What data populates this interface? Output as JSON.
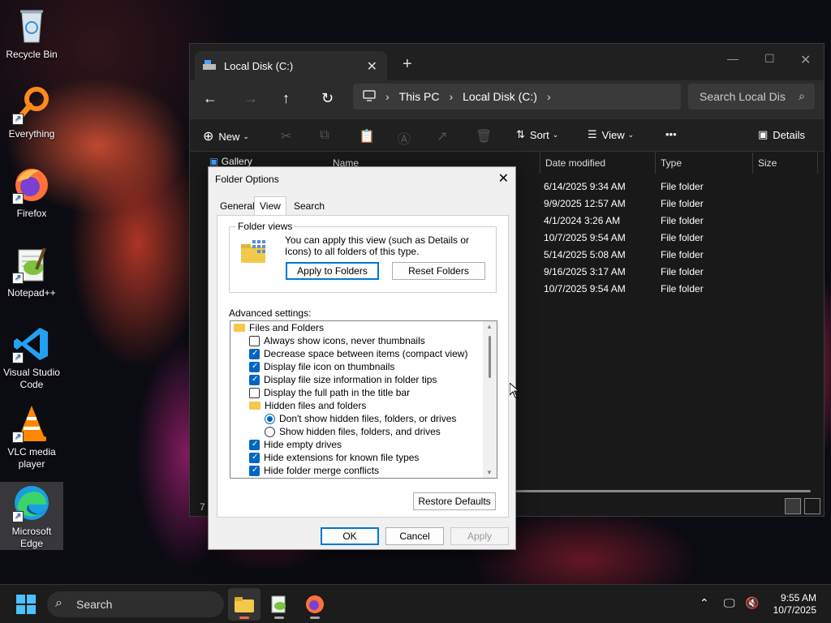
{
  "desktop": {
    "icons": [
      {
        "label": "Recycle Bin"
      },
      {
        "label": "Everything"
      },
      {
        "label": "Firefox"
      },
      {
        "label": "Notepad++"
      },
      {
        "label": "Visual Studio Code"
      },
      {
        "label": "VLC media player"
      },
      {
        "label": "Microsoft Edge"
      }
    ]
  },
  "explorer": {
    "tab_title": "Local Disk (C:)",
    "breadcrumb": [
      "This PC",
      "Local Disk (C:)"
    ],
    "search_placeholder": "Search Local Dis",
    "toolbar": {
      "new": "New",
      "sort": "Sort",
      "view": "View",
      "more": "•••",
      "details": "Details"
    },
    "nav_pane_top": "Gallery",
    "columns": {
      "name": "Name",
      "date": "Date modified",
      "type": "Type",
      "size": "Size"
    },
    "rows": [
      {
        "date": "6/14/2025 9:34 AM",
        "type": "File folder"
      },
      {
        "date": "9/9/2025 12:57 AM",
        "type": "File folder"
      },
      {
        "date": "4/1/2024 3:26 AM",
        "type": "File folder"
      },
      {
        "date": "10/7/2025 9:54 AM",
        "type": "File folder"
      },
      {
        "date": "5/14/2025 5:08 AM",
        "type": "File folder"
      },
      {
        "date": "9/16/2025 3:17 AM",
        "type": "File folder"
      },
      {
        "date": "10/7/2025 9:54 AM",
        "type": "File folder"
      }
    ],
    "status_count": "7"
  },
  "dialog": {
    "title": "Folder Options",
    "tabs": [
      "General",
      "View",
      "Search"
    ],
    "folder_views": {
      "legend": "Folder views",
      "text": "You can apply this view (such as Details or Icons) to all folders of this type.",
      "apply_btn": "Apply to Folders",
      "reset_btn": "Reset Folders"
    },
    "advanced_label": "Advanced settings:",
    "tree": [
      {
        "kind": "folder",
        "label": "Files and Folders"
      },
      {
        "kind": "check",
        "checked": false,
        "label": "Always show icons, never thumbnails"
      },
      {
        "kind": "check",
        "checked": true,
        "label": "Decrease space between items (compact view)"
      },
      {
        "kind": "check",
        "checked": true,
        "label": "Display file icon on thumbnails"
      },
      {
        "kind": "check",
        "checked": true,
        "label": "Display file size information in folder tips"
      },
      {
        "kind": "check",
        "checked": false,
        "label": "Display the full path in the title bar"
      },
      {
        "kind": "folder",
        "label": "Hidden files and folders"
      },
      {
        "kind": "radio",
        "checked": true,
        "label": "Don't show hidden files, folders, or drives"
      },
      {
        "kind": "radio",
        "checked": false,
        "label": "Show hidden files, folders, and drives"
      },
      {
        "kind": "check",
        "checked": true,
        "label": "Hide empty drives"
      },
      {
        "kind": "check",
        "checked": true,
        "label": "Hide extensions for known file types"
      },
      {
        "kind": "check",
        "checked": true,
        "label": "Hide folder merge conflicts"
      }
    ],
    "restore_btn": "Restore Defaults",
    "ok_btn": "OK",
    "cancel_btn": "Cancel",
    "apply_btn": "Apply"
  },
  "taskbar": {
    "search_label": "Search",
    "time": "9:55 AM",
    "date": "10/7/2025"
  },
  "colors": {
    "accent": "#0067c0",
    "folder": "#f3c94b"
  }
}
